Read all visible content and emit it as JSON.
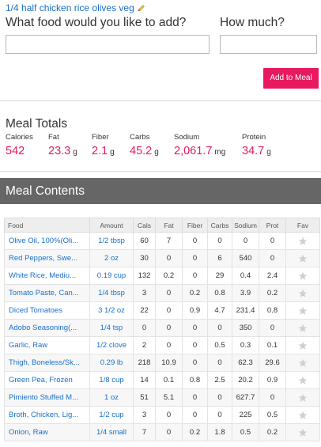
{
  "meal": {
    "name": "1/4 half chicken rice olives veg",
    "edit_icon": "pencil-icon"
  },
  "add_form": {
    "food_label": "What food would you like to add?",
    "food_value": "",
    "qty_label": "How much?",
    "qty_value": "",
    "add_button": "Add to Meal"
  },
  "totals": {
    "title": "Meal Totals",
    "items": [
      {
        "label": "Calories",
        "value": "542",
        "unit": ""
      },
      {
        "label": "Fat",
        "value": "23.3",
        "unit": "g"
      },
      {
        "label": "Fiber",
        "value": "2.1",
        "unit": "g"
      },
      {
        "label": "Carbs",
        "value": "45.2",
        "unit": "g"
      },
      {
        "label": "Sodium",
        "value": "2,061.7",
        "unit": "mg"
      },
      {
        "label": "Protein",
        "value": "34.7",
        "unit": "g"
      }
    ]
  },
  "contents": {
    "title": "Meal Contents",
    "columns": [
      "Food",
      "Amount",
      "Cals",
      "Fat",
      "Fiber",
      "Carbs",
      "Sodium",
      "Prot",
      "Fav"
    ],
    "rows": [
      {
        "food": "Olive Oil, 100%(Oli...",
        "amount": "1/2 tbsp",
        "cals": "60",
        "fat": "7",
        "fiber": "0",
        "carbs": "0",
        "sodium": "0",
        "prot": "0"
      },
      {
        "food": "Red Peppers, Swe...",
        "amount": "2 oz",
        "cals": "30",
        "fat": "0",
        "fiber": "0",
        "carbs": "6",
        "sodium": "540",
        "prot": "0"
      },
      {
        "food": "White Rice, Mediu...",
        "amount": "0.19 cup",
        "cals": "132",
        "fat": "0.2",
        "fiber": "0",
        "carbs": "29",
        "sodium": "0.4",
        "prot": "2.4"
      },
      {
        "food": "Tomato Paste, Can...",
        "amount": "1/4 tbsp",
        "cals": "3",
        "fat": "0",
        "fiber": "0.2",
        "carbs": "0.8",
        "sodium": "3.9",
        "prot": "0.2"
      },
      {
        "food": "Diced Tomatoes",
        "amount": "3 1/2 oz",
        "cals": "22",
        "fat": "0",
        "fiber": "0.9",
        "carbs": "4.7",
        "sodium": "231.4",
        "prot": "0.8"
      },
      {
        "food": "Adobo Seasoning(...",
        "amount": "1/4 tsp",
        "cals": "0",
        "fat": "0",
        "fiber": "0",
        "carbs": "0",
        "sodium": "350",
        "prot": "0"
      },
      {
        "food": "Garlic, Raw",
        "amount": "1/2 clove",
        "cals": "2",
        "fat": "0",
        "fiber": "0",
        "carbs": "0.5",
        "sodium": "0.3",
        "prot": "0.1"
      },
      {
        "food": "Thigh, Boneless/Sk...",
        "amount": "0.29 lb",
        "cals": "218",
        "fat": "10.9",
        "fiber": "0",
        "carbs": "0",
        "sodium": "62.3",
        "prot": "29.6"
      },
      {
        "food": "Green Pea, Frozen",
        "amount": "1/8 cup",
        "cals": "14",
        "fat": "0.1",
        "fiber": "0.8",
        "carbs": "2.5",
        "sodium": "20.2",
        "prot": "0.9"
      },
      {
        "food": "Pimiento Stuffed M...",
        "amount": "1 oz",
        "cals": "51",
        "fat": "5.1",
        "fiber": "0",
        "carbs": "0",
        "sodium": "627.7",
        "prot": "0"
      },
      {
        "food": "Broth, Chicken, Lig...",
        "amount": "1/2 cup",
        "cals": "3",
        "fat": "0",
        "fiber": "0",
        "carbs": "0",
        "sodium": "225",
        "prot": "0.5"
      },
      {
        "food": "Onion, Raw",
        "amount": "1/4 small",
        "cals": "7",
        "fat": "0",
        "fiber": "0.2",
        "carbs": "1.8",
        "sodium": "0.5",
        "prot": "0.2"
      }
    ],
    "fav_icon": "star-icon"
  },
  "colors": {
    "accent": "#e8195e",
    "link": "#1a6fc9",
    "header_bar": "#666666"
  }
}
